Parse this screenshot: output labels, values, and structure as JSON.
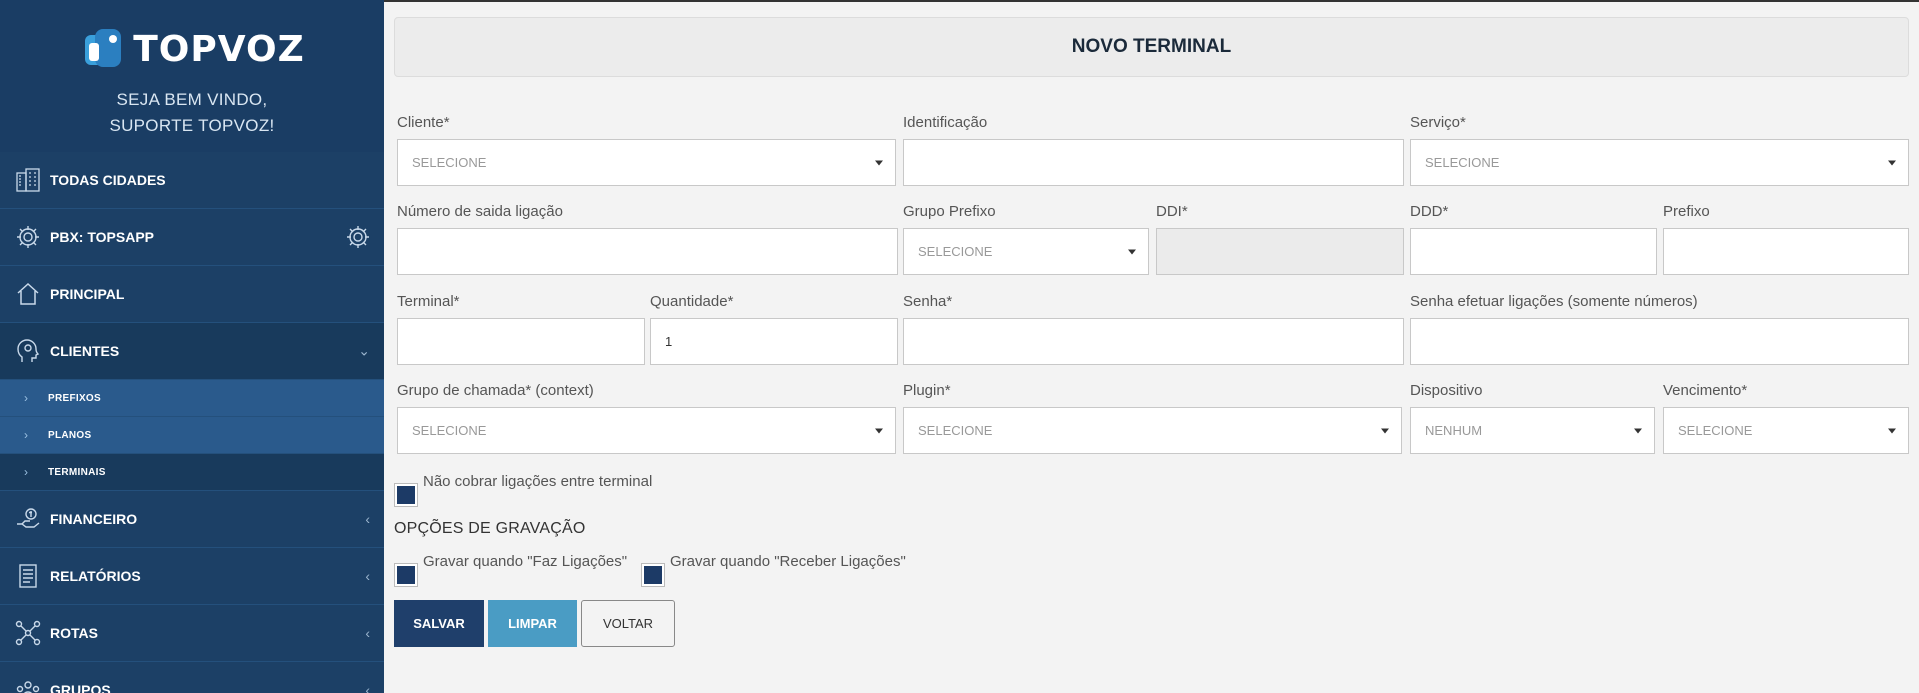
{
  "brand": {
    "name": "TOPVOZ",
    "welcome_line1": "SEJA BEM VINDO,",
    "welcome_line2": "SUPORTE TOPVOZ!"
  },
  "sidebar": {
    "items": [
      {
        "label": "TODAS CIDADES",
        "icon": "buildings-icon"
      },
      {
        "label": "PBX: TOPSAPP",
        "icon": "gear-icon"
      },
      {
        "label": "PRINCIPAL",
        "icon": "home-icon"
      },
      {
        "label": "CLIENTES",
        "icon": "user-head-icon"
      },
      {
        "label": "FINANCEIRO",
        "icon": "money-icon"
      },
      {
        "label": "RELATÓRIOS",
        "icon": "report-icon"
      },
      {
        "label": "ROTAS",
        "icon": "network-icon"
      },
      {
        "label": "GRUPOS",
        "icon": "group-icon"
      }
    ],
    "submenu": [
      {
        "label": "PREFIXOS"
      },
      {
        "label": "PLANOS"
      },
      {
        "label": "TERMINAIS"
      }
    ]
  },
  "page": {
    "title": "NOVO TERMINAL"
  },
  "form": {
    "cliente": {
      "label": "Cliente*",
      "value": "SELECIONE"
    },
    "identificacao": {
      "label": "Identificação",
      "value": ""
    },
    "servico": {
      "label": "Serviço*",
      "value": "SELECIONE"
    },
    "numero_saida": {
      "label": "Número de saida ligação",
      "value": ""
    },
    "grupo_prefixo": {
      "label": "Grupo Prefixo",
      "value": "SELECIONE"
    },
    "ddi": {
      "label": "DDI*",
      "value": ""
    },
    "ddd": {
      "label": "DDD*",
      "value": ""
    },
    "prefixo": {
      "label": "Prefixo",
      "value": ""
    },
    "terminal": {
      "label": "Terminal*",
      "value": ""
    },
    "quantidade": {
      "label": "Quantidade*",
      "value": "1"
    },
    "senha": {
      "label": "Senha*",
      "value": ""
    },
    "senha_ligacoes": {
      "label": "Senha efetuar ligações (somente números)",
      "value": ""
    },
    "grupo_chamada": {
      "label": "Grupo de chamada* (context)",
      "value": "SELECIONE"
    },
    "plugin": {
      "label": "Plugin*",
      "value": "SELECIONE"
    },
    "dispositivo": {
      "label": "Dispositivo",
      "value": "NENHUM"
    },
    "vencimento": {
      "label": "Vencimento*",
      "value": "SELECIONE"
    },
    "nao_cobrar": {
      "label": "Não cobrar ligações entre terminal"
    },
    "gravacao_title": "OPÇÕES DE GRAVAÇÃO",
    "gravar_faz": {
      "label": "Gravar quando \"Faz Ligações\""
    },
    "gravar_receber": {
      "label": "Gravar quando \"Receber Ligações\""
    }
  },
  "buttons": {
    "salvar": "SALVAR",
    "limpar": "LIMPAR",
    "voltar": "VOLTAR"
  },
  "colors": {
    "sidebar": "#1c4066",
    "submenu": "#2a5a8c",
    "primary": "#1f3f6b",
    "secondary": "#4a9cc4"
  }
}
